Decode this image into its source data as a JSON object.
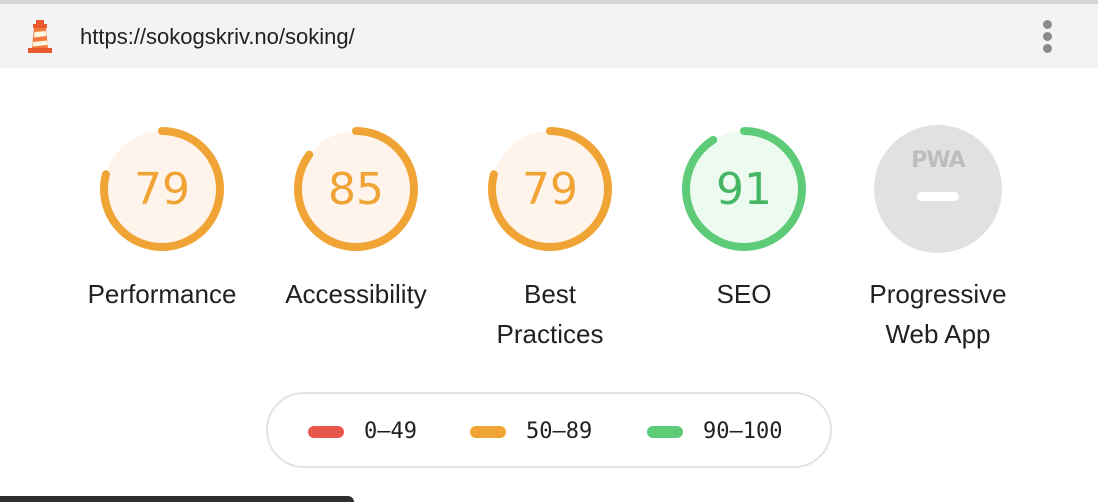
{
  "browser": {
    "url": "https://sokogskriv.no/soking/",
    "logo_icon": "lighthouse-icon",
    "menu_icon": "more-vertical-icon"
  },
  "colors": {
    "fail": "#e8574a",
    "average": "#f0a436",
    "pass": "#5ecb78",
    "average_bg": "#fff4ec",
    "pass_bg": "#edfaf0",
    "pwa_bg": "#e1e1e1",
    "average_text": "#f0a436",
    "pass_text": "#45b663"
  },
  "categories": [
    {
      "label": "Performance",
      "score": "79",
      "fraction": 0.79,
      "rating": "average"
    },
    {
      "label": "Accessibility",
      "score": "85",
      "fraction": 0.85,
      "rating": "average"
    },
    {
      "label": "Best Practices",
      "score": "79",
      "fraction": 0.79,
      "rating": "average"
    },
    {
      "label": "SEO",
      "score": "91",
      "fraction": 0.91,
      "rating": "pass"
    },
    {
      "label": "Progressive Web App",
      "badge": "PWA",
      "rating": "pwa"
    }
  ],
  "legend": [
    {
      "range": "0–49",
      "rating": "fail"
    },
    {
      "range": "50–89",
      "rating": "average"
    },
    {
      "range": "90–100",
      "rating": "pass"
    }
  ]
}
